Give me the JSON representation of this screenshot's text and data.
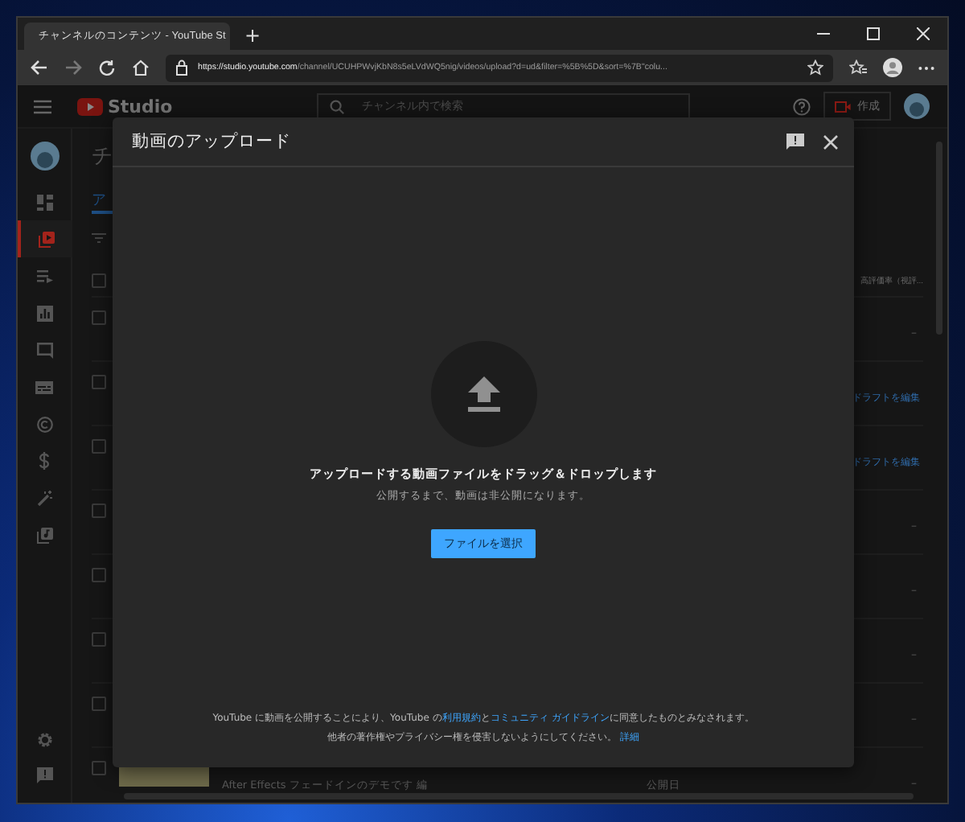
{
  "browser": {
    "tab_title": "チャンネルのコンテンツ - YouTube St",
    "new_tab": "+",
    "url_host": "https://studio.youtube.com",
    "url_path": "/channel/UCUHPWvjKbN8s5eLVdWQ5nig/videos/upload?d=ud&filter=%5B%5D&sort=%7B\"colu..."
  },
  "studio": {
    "logo": "Studio",
    "search_placeholder": "チャンネル内で検索",
    "create_button": "作成",
    "page_title": "チ",
    "tab": "ア",
    "sidebar_items": [
      {
        "kind": "dashboard",
        "selected": false
      },
      {
        "kind": "content",
        "selected": true
      },
      {
        "kind": "playlists",
        "selected": false
      },
      {
        "kind": "analytics",
        "selected": false
      },
      {
        "kind": "comments",
        "selected": false
      },
      {
        "kind": "subtitles",
        "selected": false
      },
      {
        "kind": "copyright",
        "selected": false
      },
      {
        "kind": "earn",
        "selected": false
      },
      {
        "kind": "customize",
        "selected": false
      },
      {
        "kind": "audio",
        "selected": false
      }
    ],
    "rows": [
      {
        "kind": "header",
        "checked": false,
        "text": "高評価率（視評..."
      },
      {
        "kind": "dash",
        "checked": false,
        "text": "–"
      },
      {
        "kind": "link",
        "checked": false,
        "text": "ドラフトを編集"
      },
      {
        "kind": "link",
        "checked": false,
        "text": "ドラフトを編集"
      },
      {
        "kind": "dash",
        "checked": false,
        "text": "–"
      },
      {
        "kind": "dash",
        "checked": false,
        "text": "–"
      },
      {
        "kind": "dash",
        "checked": false,
        "text": "–"
      },
      {
        "kind": "dash",
        "checked": false,
        "text": "–"
      },
      {
        "kind": "video",
        "checked": false,
        "text": "–",
        "subtitle": "After Effects フェードインのデモです 編",
        "date_label": "公開日"
      }
    ]
  },
  "modal": {
    "title": "動画のアップロード",
    "drop_title": "アップロードする動画ファイルをドラッグ＆ドロップします",
    "drop_subtitle": "公開するまで、動画は非公開になります。",
    "select_button": "ファイルを選択",
    "legal_lines": [
      [
        {
          "text": "YouTube に動画を公開することにより、YouTube の",
          "link": false
        },
        {
          "text": "利用規約",
          "link": true
        },
        {
          "text": "と",
          "link": false
        },
        {
          "text": "コミュニティ ガイドライン",
          "link": true
        },
        {
          "text": "に同意したものとみなされます。",
          "link": false
        }
      ],
      [
        {
          "text": "他者の著作権やプライバシー権を侵害しないようにしてください。 ",
          "link": false
        },
        {
          "text": "詳細",
          "link": true
        }
      ]
    ]
  }
}
